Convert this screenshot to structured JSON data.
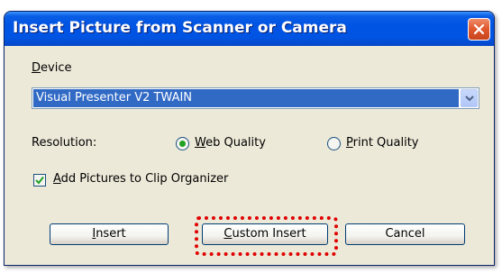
{
  "dialog": {
    "title": "Insert Picture from Scanner or Camera",
    "device": {
      "label_accel": "D",
      "label_rest": "evice",
      "selected_value": "Visual Presenter V2 TWAIN"
    },
    "resolution": {
      "label": "Resolution:",
      "options": [
        {
          "accel": "W",
          "rest": "eb Quality",
          "selected": true
        },
        {
          "accel": "P",
          "rest": "rint Quality",
          "selected": false
        }
      ]
    },
    "add_to_organizer": {
      "accel": "A",
      "rest": "dd Pictures to Clip Organizer",
      "checked": true
    },
    "buttons": {
      "insert": {
        "accel": "I",
        "rest": "nsert"
      },
      "custom_insert": {
        "accel": "C",
        "rest": "ustom Insert"
      },
      "cancel": "Cancel"
    }
  },
  "colors": {
    "titlebar": "#0054e3",
    "selection": "#316ac5",
    "highlight": "#e00000",
    "radio_dot": "#21a121"
  },
  "icons": {
    "close": "close-icon",
    "dropdown": "chevron-down-icon",
    "check": "checkmark-icon"
  }
}
